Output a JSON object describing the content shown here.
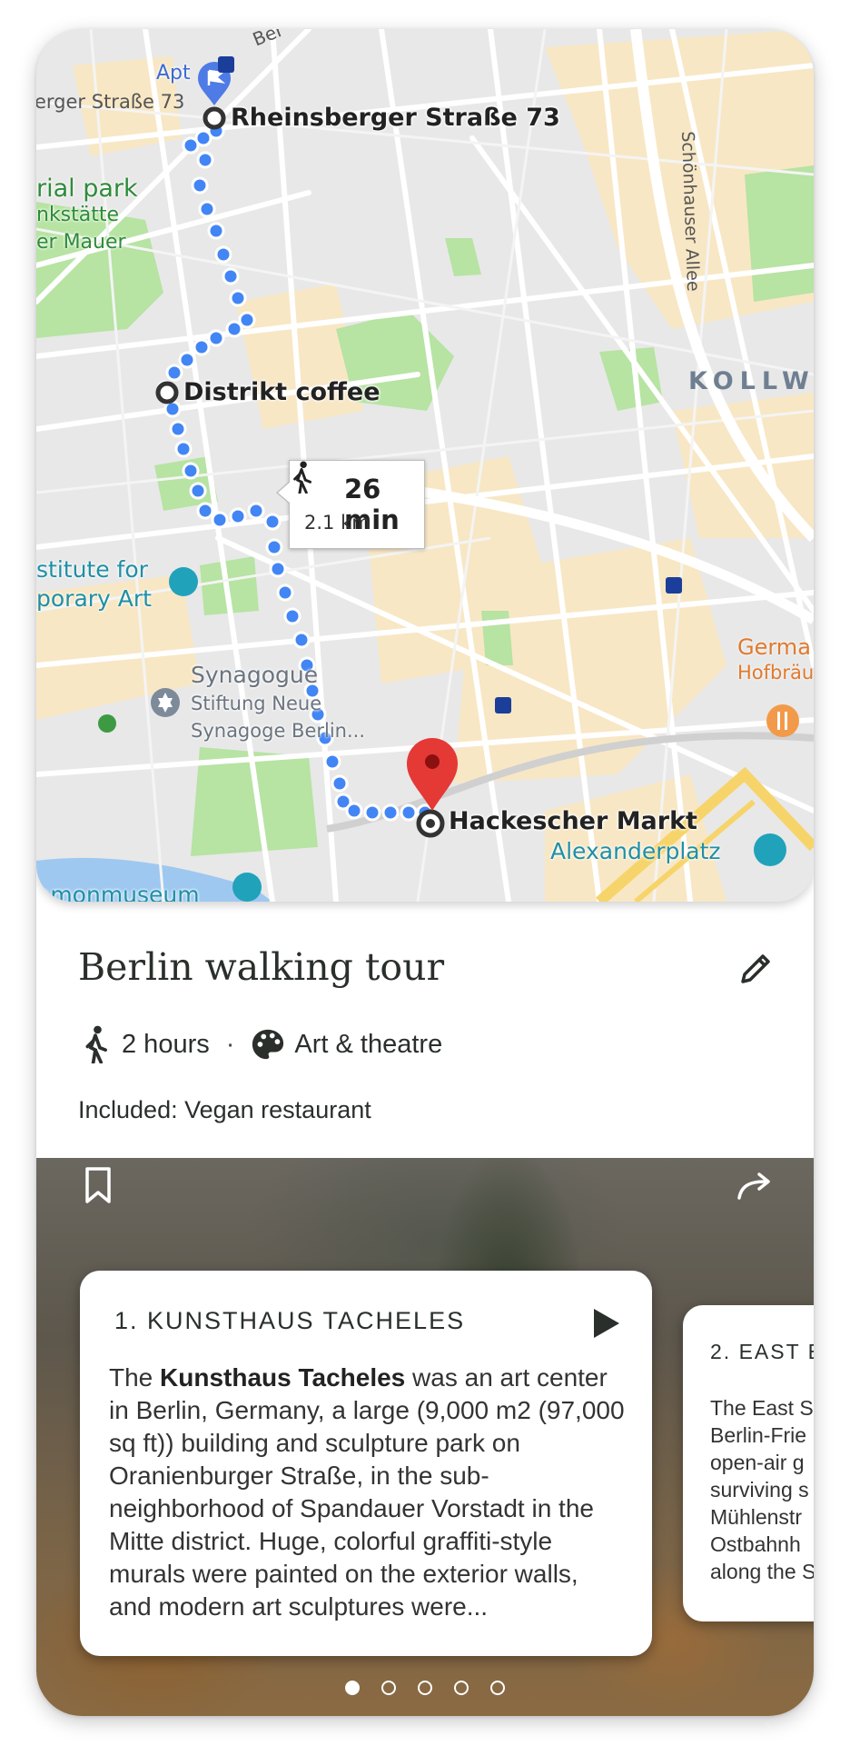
{
  "map": {
    "route_time": "26 min",
    "route_distance": "2.1 km",
    "stops": [
      "Rheinsberger Straße 73",
      "Distrikt coffee",
      "Hackescher Markt"
    ],
    "labels": {
      "apt": "Apt",
      "street_top": "erger Straße 73",
      "memorial_1": "rial park",
      "memorial_2": "nkstätte",
      "memorial_3": "er Mauer",
      "district": "KOLLW",
      "institute_1": "stitute for",
      "institute_2": "porary Art",
      "synagogue_1": "Synagogue",
      "synagogue_2": "Stiftung Neue",
      "synagogue_3": "Synagoge Berlin...",
      "german_1": "Germa",
      "german_2": "Hofbräu",
      "alexanderplatz": "Alexanderplatz",
      "museum": "amonmuseum",
      "schoenhauser": "Schönhauser Allee",
      "top_street": "Ber"
    },
    "colors": {
      "route": "#4285f4",
      "pin": "#e53935"
    }
  },
  "tour": {
    "title": "Berlin walking tour",
    "duration": "2 hours",
    "separator": "·",
    "category": "Art & theatre",
    "included": "Included: Vegan restaurant"
  },
  "icons": {
    "walk": "walk-icon",
    "palette": "palette-icon",
    "edit": "pencil-icon",
    "bookmark": "bookmark-icon",
    "share": "share-icon",
    "play": "play-icon"
  },
  "cards": [
    {
      "title": "1. KUNSTHAUS TACHELES",
      "body_prefix": "The ",
      "body_bold": "Kunsthaus Tacheles",
      "body_rest": " was an art center in Berlin, Germany, a large (9,000 m2 (97,000 sq ft)) building and sculpture park on Oranienburger Straße, in the sub-neighborhood of Spandauer Vorstadt in the Mitte district. Huge, colorful graffiti-style murals were painted on the exterior walls, and modern art sculptures were..."
    },
    {
      "title": "2. EAST E",
      "lines": [
        "The East S",
        "Berlin-Frie",
        "open-air g",
        "surviving s",
        "Mühlenstr",
        "Ostbahnh",
        "along the S"
      ]
    }
  ],
  "pagination": {
    "total": 5,
    "active": 0
  }
}
